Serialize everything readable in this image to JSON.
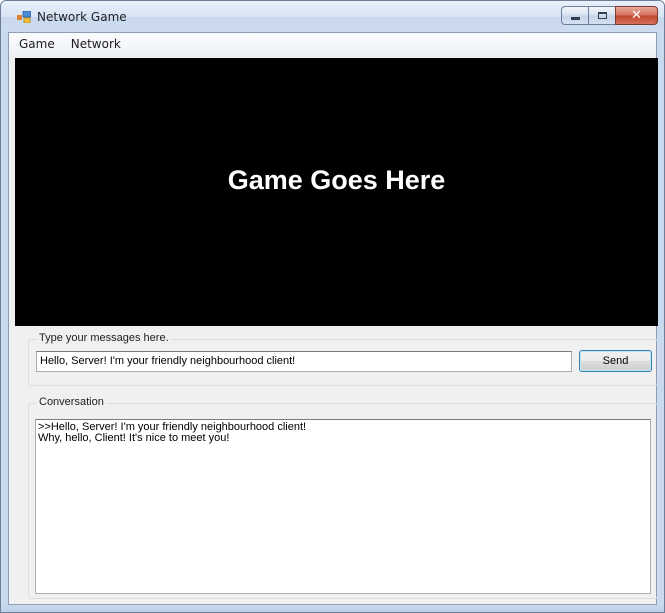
{
  "window": {
    "title": "Network Game"
  },
  "menu": {
    "items": [
      {
        "label": "Game"
      },
      {
        "label": "Network"
      }
    ]
  },
  "game_area": {
    "text": "Game Goes Here"
  },
  "input_group": {
    "label": "Type your messages here.",
    "value": "Hello, Server! I'm your friendly neighbourhood client!",
    "send_label": "Send"
  },
  "conversation": {
    "label": "Conversation",
    "lines": [
      ">>Hello, Server! I'm your friendly neighbourhood client!",
      "Why, hello, Client! It's nice to meet you!"
    ]
  },
  "colors": {
    "game_background": "#000000",
    "game_text": "#ffffff",
    "close_button": "#c2452d",
    "send_border": "#3c7fb1"
  },
  "icons": [
    "app-icon",
    "minimize-icon",
    "maximize-icon",
    "close-icon"
  ]
}
